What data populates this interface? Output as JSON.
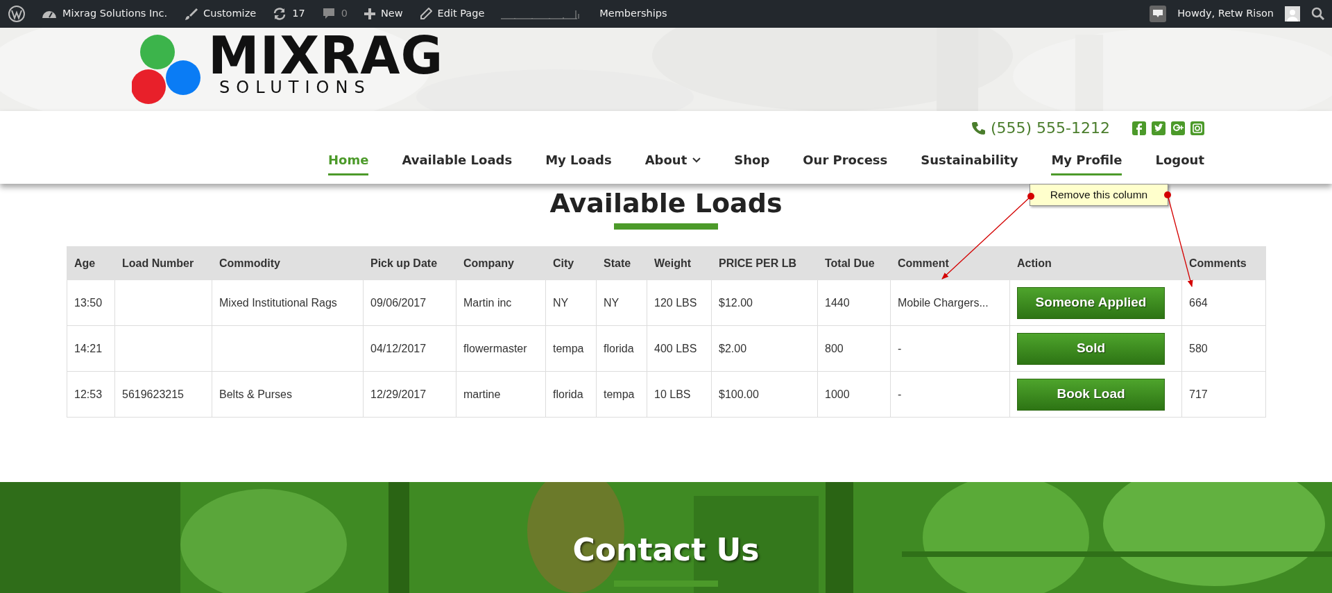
{
  "admin_bar": {
    "left": [
      {
        "kind": "wp"
      },
      {
        "kind": "dashboard",
        "label": "Mixrag Solutions Inc."
      },
      {
        "kind": "brush",
        "label": "Customize"
      },
      {
        "kind": "updates",
        "label": "17"
      },
      {
        "kind": "comments",
        "label": "0"
      },
      {
        "kind": "plus",
        "label": "New"
      },
      {
        "kind": "pencil",
        "label": "Edit Page"
      },
      {
        "kind": "graph"
      },
      {
        "kind": "text",
        "label": "Memberships"
      }
    ],
    "right": [
      {
        "kind": "notice"
      },
      {
        "kind": "account",
        "label": "Howdy, Retw Rison"
      },
      {
        "kind": "search"
      }
    ]
  },
  "header": {
    "logo": {
      "name": "MIXRAG",
      "tagline": "SOLUTIONS"
    },
    "phone": "(555) 555-1212",
    "social": [
      {
        "kind": "facebook"
      },
      {
        "kind": "twitter"
      },
      {
        "kind": "google-plus"
      },
      {
        "kind": "instagram"
      }
    ],
    "nav": [
      {
        "label": "Home",
        "selected": true,
        "underlined": true
      },
      {
        "label": "Available Loads",
        "selected": false,
        "underlined": false
      },
      {
        "label": "My Loads",
        "selected": false,
        "underlined": false
      },
      {
        "label": "About",
        "selected": false,
        "underlined": false,
        "dropdown": true
      },
      {
        "label": "Shop",
        "selected": false,
        "underlined": false
      },
      {
        "label": "Our Process",
        "selected": false,
        "underlined": false
      },
      {
        "label": "Sustainability",
        "selected": false,
        "underlined": false
      },
      {
        "label": "My Profile",
        "selected": false,
        "underlined": true
      },
      {
        "label": "Logout",
        "selected": false,
        "underlined": false
      }
    ]
  },
  "page_title": "Available Loads",
  "table": {
    "columns": [
      "Age",
      "Load Number",
      "Commodity",
      "Pick up Date",
      "Company",
      "City",
      "State",
      "Weight",
      "PRICE PER LB",
      "Total Due",
      "Comment",
      "Action",
      "Comments"
    ],
    "rows": [
      {
        "cells": [
          "13:50",
          null,
          "Mixed Institutional Rags",
          "09/06/2017",
          "Martin inc",
          "NY",
          "NY",
          "120 LBS",
          "$12.00",
          "1440",
          "Mobile Chargers..."
        ],
        "action": "Someone Applied",
        "comments": "664"
      },
      {
        "cells": [
          "14:21",
          null,
          null,
          "04/12/2017",
          "flowermaster",
          "tempa",
          "florida",
          "400 LBS",
          "$2.00",
          "800",
          "-"
        ],
        "action": "Sold",
        "comments": "580"
      },
      {
        "cells": [
          "12:53",
          "5619623215",
          "Belts & Purses",
          "12/29/2017",
          "martine",
          "florida",
          "tempa",
          "10 LBS",
          "$100.00",
          "1000",
          "-"
        ],
        "action": "Book Load",
        "comments": "717"
      }
    ]
  },
  "annotation": {
    "text": "Remove this column"
  },
  "contact": {
    "title": "Contact Us"
  }
}
